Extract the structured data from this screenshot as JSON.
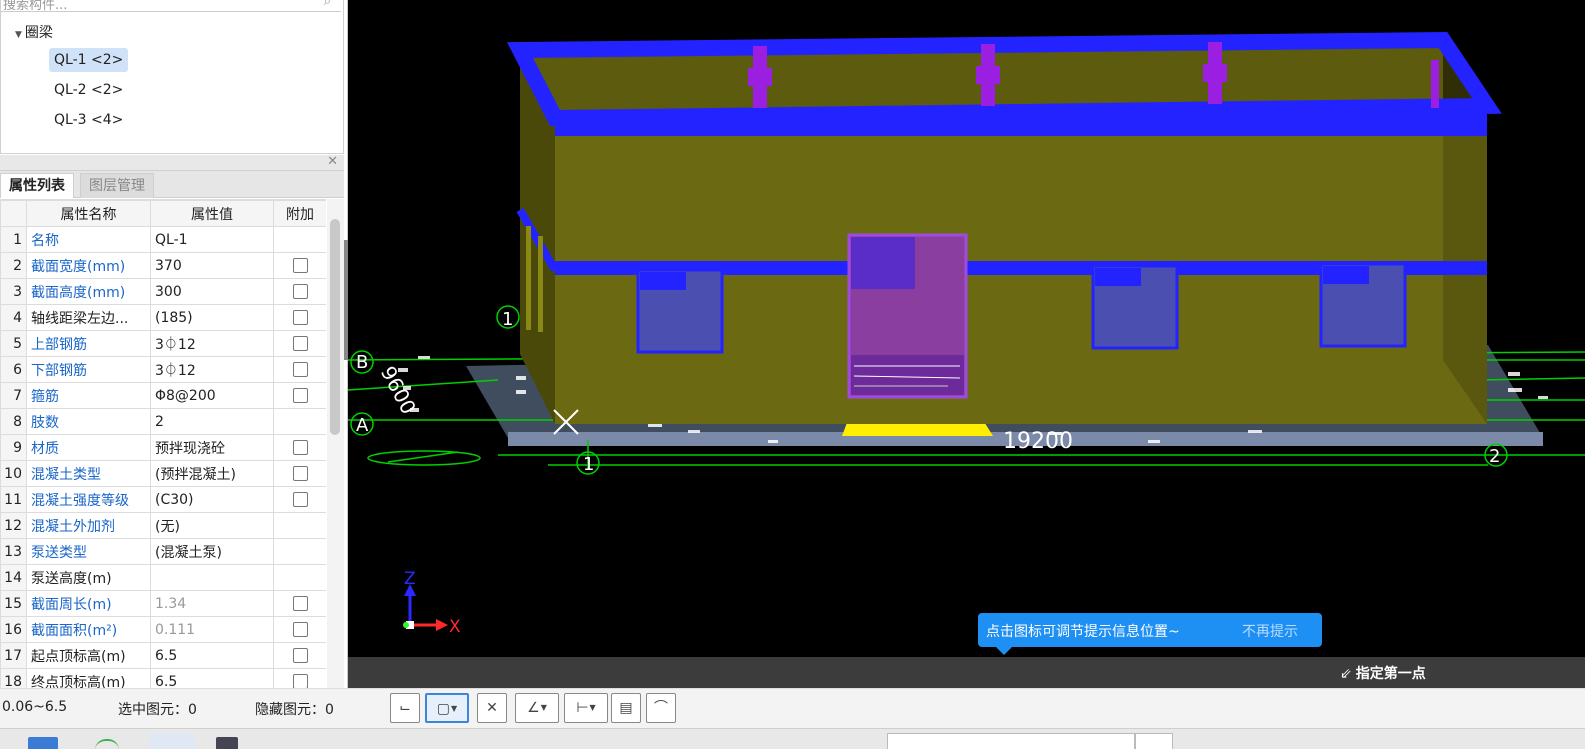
{
  "tree": {
    "search_placeholder": "搜索构件...",
    "root": "圈梁",
    "items": [
      {
        "label": "QL-1 <2>",
        "selected": true
      },
      {
        "label": "QL-2 <2>",
        "selected": false
      },
      {
        "label": "QL-3 <4>",
        "selected": false
      }
    ]
  },
  "tabs": {
    "properties": "属性列表",
    "layers": "图层管理"
  },
  "grid": {
    "headers": {
      "name": "属性名称",
      "value": "属性值",
      "extra": "附加"
    },
    "rows": [
      {
        "n": "1",
        "name": "名称",
        "value": "QL-1",
        "blue": true,
        "check": false
      },
      {
        "n": "2",
        "name": "截面宽度(mm)",
        "value": "370",
        "blue": true,
        "check": true
      },
      {
        "n": "3",
        "name": "截面高度(mm)",
        "value": "300",
        "blue": true,
        "check": true
      },
      {
        "n": "4",
        "name": "轴线距梁左边...",
        "value": "(185)",
        "blue": false,
        "check": true
      },
      {
        "n": "5",
        "name": "上部钢筋",
        "value": "3⏀12",
        "blue": true,
        "check": true
      },
      {
        "n": "6",
        "name": "下部钢筋",
        "value": "3⏀12",
        "blue": true,
        "check": true
      },
      {
        "n": "7",
        "name": "箍筋",
        "value": "Φ8@200",
        "blue": true,
        "check": true
      },
      {
        "n": "8",
        "name": "肢数",
        "value": "2",
        "blue": true,
        "check": false
      },
      {
        "n": "9",
        "name": "材质",
        "value": "预拌现浇砼",
        "blue": true,
        "check": true
      },
      {
        "n": "10",
        "name": "混凝土类型",
        "value": "(预拌混凝土)",
        "blue": true,
        "check": true
      },
      {
        "n": "11",
        "name": "混凝土强度等级",
        "value": "(C30)",
        "blue": true,
        "check": true
      },
      {
        "n": "12",
        "name": "混凝土外加剂",
        "value": "(无)",
        "blue": true,
        "check": false
      },
      {
        "n": "13",
        "name": "泵送类型",
        "value": "(混凝土泵)",
        "blue": true,
        "check": false
      },
      {
        "n": "14",
        "name": "泵送高度(m)",
        "value": "",
        "blue": false,
        "check": false
      },
      {
        "n": "15",
        "name": "截面周长(m)",
        "value": "1.34",
        "blue": true,
        "check": true,
        "grey": true
      },
      {
        "n": "16",
        "name": "截面面积(m²)",
        "value": "0.111",
        "blue": true,
        "check": true,
        "grey": true
      },
      {
        "n": "17",
        "name": "起点顶标高(m)",
        "value": "6.5",
        "blue": false,
        "check": true
      },
      {
        "n": "18",
        "name": "终点顶标高(m)",
        "value": "6.5",
        "blue": false,
        "check": true
      }
    ]
  },
  "viewport": {
    "dimension_length": "19200",
    "dimension_width": "9600",
    "axis_labels": [
      "1",
      "2",
      "A",
      "B",
      "1"
    ],
    "axis_x": "X",
    "axis_z": "Z"
  },
  "tip": {
    "message": "点击图标可调节提示信息位置~",
    "dismiss": "不再提示"
  },
  "command": {
    "prompt": "指定第一点"
  },
  "status": {
    "elevation": "0.06~6.5",
    "selected": "选中图元：0",
    "hidden": "隐藏图元：0"
  },
  "colors": {
    "wall": "#6b6a12",
    "beam": "#2323ff",
    "column": "#9b1fe0",
    "grid_line": "#00d000",
    "tip": "#1e8ff3",
    "accent": "#3b86d9"
  }
}
